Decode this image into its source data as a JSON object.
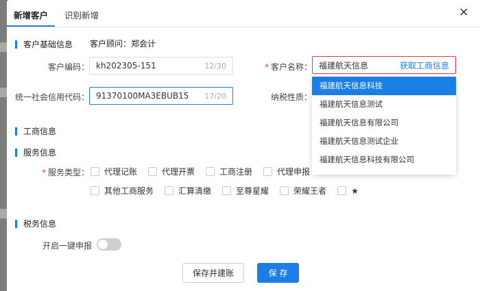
{
  "tabs": [
    {
      "label": "新增客户"
    },
    {
      "label": "识别新增"
    }
  ],
  "close_glyph": "×",
  "sections": {
    "basic": "客户基础信息",
    "business": "工商信息",
    "service": "服务信息",
    "tax": "税务信息"
  },
  "adviser": "客户顾问：郑会计",
  "fields": {
    "code": {
      "label": "客户编码：",
      "value": "kh202305-151",
      "count": "12/30"
    },
    "credit_code": {
      "label": "统一社会信用代码：",
      "value": "91370100MA3EBUB15",
      "count": "17/20"
    },
    "name": {
      "required": "*",
      "label": "客户名称：",
      "value": "福建航天信息",
      "action": "获取工商信息"
    },
    "tax_nature": {
      "label": "纳税性质："
    }
  },
  "name_suggestions": [
    "福建航天信息科技",
    "福建航天信息测试",
    "福建航天信息有限公司",
    "福建航天信息测试企业",
    "福建航天信息科技有限公司"
  ],
  "service_types": {
    "required": "*",
    "label": "服务类型：",
    "row1": [
      "代理记账",
      "代理开票",
      "工商注册",
      "代理申报"
    ],
    "row2": [
      "其他工商服务",
      "汇算清缴",
      "至尊星耀",
      "荣耀王者",
      "★"
    ]
  },
  "one_click_filing": {
    "label": "开启一键申报",
    "on": false
  },
  "buttons": {
    "save_and_bookkeep": "保存并建账",
    "save": "保 存"
  },
  "colors": {
    "accent": "#1a7ee6",
    "error": "#e4393c"
  }
}
